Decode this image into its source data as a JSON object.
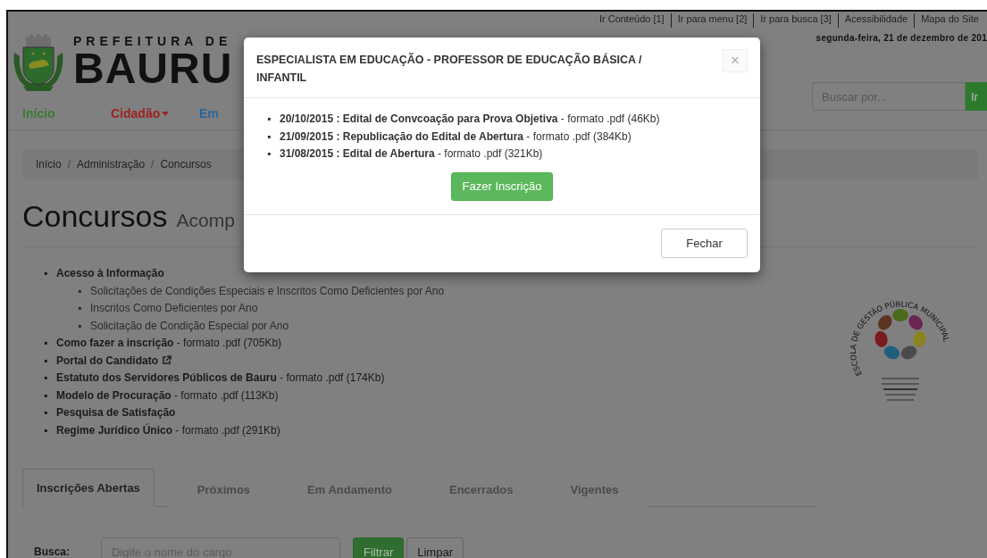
{
  "top_links": [
    "Ir Conteúdo [1]",
    "Ir para menu [2]",
    "Ir para busca [3]",
    "Acessibilidade",
    "Mapa do Site"
  ],
  "date": "segunda-feira, 21 de dezembro de 201",
  "logo": {
    "line1": "PREFEITURA DE",
    "line2": "BAURU"
  },
  "search": {
    "placeholder": "Buscar por...",
    "button": "Ir"
  },
  "nav": [
    {
      "label": "Início",
      "color": "#3d7a36",
      "dropdown": false
    },
    {
      "label": "Cidadão",
      "color": "#9e2222",
      "dropdown": true
    },
    {
      "label": "Em",
      "color": "#2b669c",
      "dropdown": false
    }
  ],
  "breadcrumb": [
    "Início",
    "Administração",
    "Concursos"
  ],
  "breadcrumb_separator": "/",
  "list_marker": "▪",
  "page_title": "Concursos",
  "page_subtitle": "Acomp",
  "links": [
    {
      "text": "**Acesso à Informação**",
      "external": false,
      "children": [
        {
          "text": "Solicitações de Condições Especiais e Inscritos Como Deficientes por Ano",
          "external": false
        },
        {
          "text": "Inscritos Como Deficientes por Ano",
          "external": false
        },
        {
          "text": "Solicitação de Condição Especial por Ano",
          "external": false
        }
      ]
    },
    {
      "text": "**Como fazer a inscrição** - formato .pdf (705Kb)",
      "external": false
    },
    {
      "text": "**Portal do Candidato**",
      "external": true
    },
    {
      "text": "**Estatuto dos Servidores Públicos de Bauru** - formato .pdf (174Kb)",
      "external": false
    },
    {
      "text": "**Modelo de Procuração** - formato .pdf (113Kb)",
      "external": false
    },
    {
      "text": "**Pesquisa de Satisfação**",
      "external": false
    },
    {
      "text": "**Regime Jurídico Único** - formato .pdf (291Kb)",
      "external": false
    }
  ],
  "side_logo": {
    "ring_text": "ESCOLA DE GESTÃO PÚBLICA MUNICIPAL"
  },
  "tabs": [
    {
      "label": "Inscrições Abertas",
      "selected": true
    },
    {
      "label": "Próximos",
      "selected": false
    },
    {
      "label": "Em Andamento",
      "selected": false
    },
    {
      "label": "Encerrados",
      "selected": false
    },
    {
      "label": "Vigentes",
      "selected": false
    }
  ],
  "filter": {
    "label": "Busca:",
    "placeholder": "Digite o nome do cargo",
    "submit": "Filtrar",
    "reset": "Limpar"
  },
  "modal": {
    "title": "ESPECIALISTA EM EDUCAÇÃO - PROFESSOR DE EDUCAÇÃO BÁSICA / INFANTIL",
    "close_glyph": "×",
    "items": [
      "**20/10/2015 : Edital de Convcoação para Prova Objetiva** - formato .pdf (46Kb)",
      "**21/09/2015 : Republicação do Edital de Abertura** - formato .pdf (384Kb)",
      "**31/08/2015 : Edital de Abertura** - formato .pdf (321Kb)"
    ],
    "primary_button": "Fazer Inscrição",
    "footer_button": "Fechar"
  }
}
